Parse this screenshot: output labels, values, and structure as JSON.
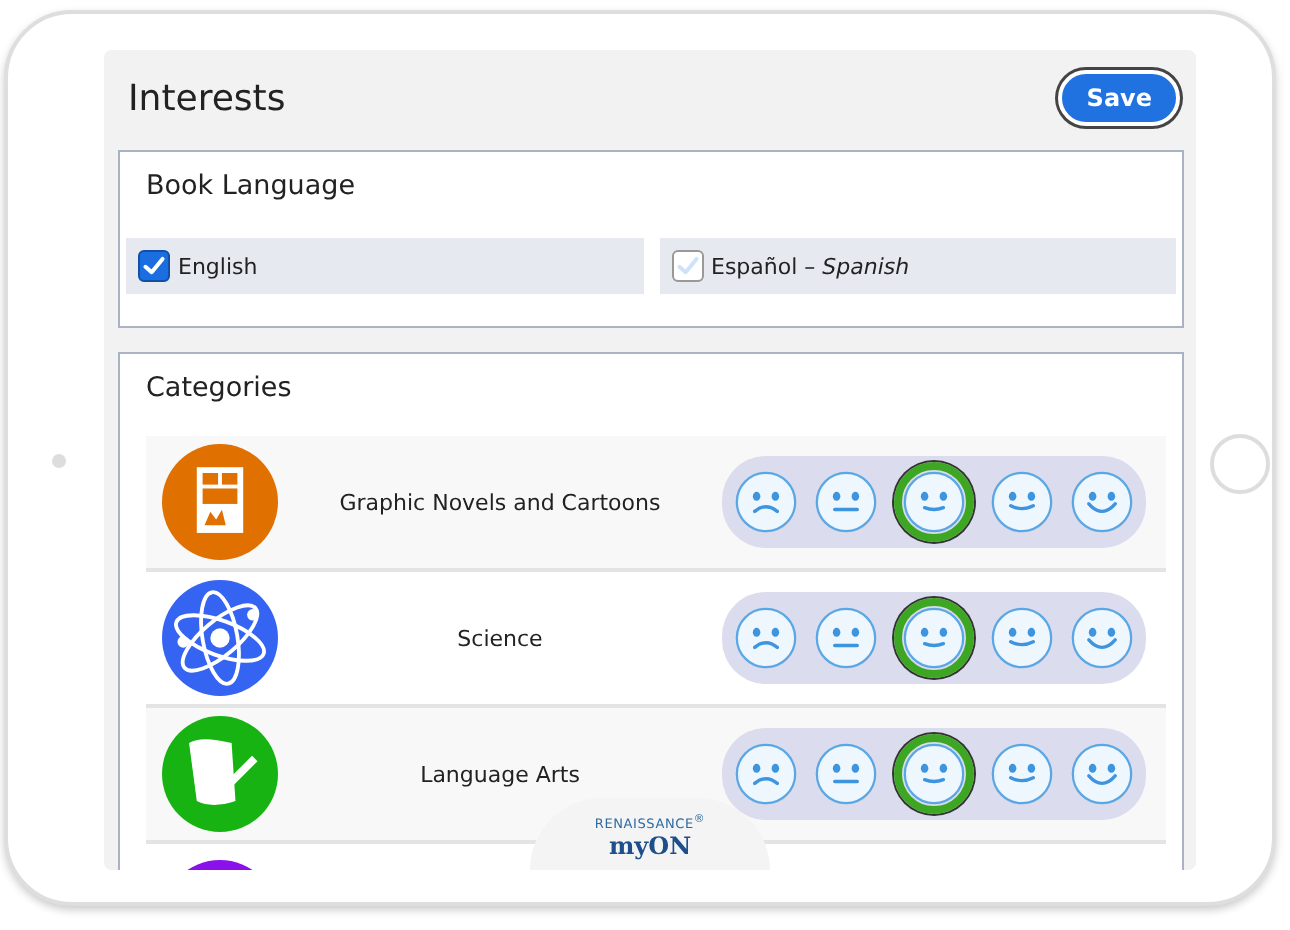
{
  "header": {
    "title": "Interests",
    "save_button": "Save"
  },
  "book_language": {
    "title": "Book Language",
    "options": [
      {
        "label": "English",
        "checked": true
      },
      {
        "label": "Español – *Spanish*",
        "checked": false
      }
    ]
  },
  "categories": {
    "title": "Categories",
    "items": [
      {
        "kind": "comic",
        "name": "Graphic Novels and Cartoons",
        "color": "#e07000",
        "faces": [
          {
            "selected": false
          },
          {
            "selected": false
          },
          {
            "selected": true
          },
          {
            "selected": false
          },
          {
            "selected": false
          }
        ]
      },
      {
        "kind": "atom",
        "name": "Science",
        "color": "#3563f2",
        "faces": [
          {
            "selected": false
          },
          {
            "selected": false
          },
          {
            "selected": true
          },
          {
            "selected": false
          },
          {
            "selected": false
          }
        ]
      },
      {
        "kind": "scroll",
        "name": "Language Arts",
        "color": "#17b312",
        "faces": [
          {
            "selected": false
          },
          {
            "selected": false
          },
          {
            "selected": true
          },
          {
            "selected": false
          },
          {
            "selected": false
          }
        ]
      },
      {
        "kind": "partial",
        "color": "#8a12e8"
      }
    ]
  },
  "logo": {
    "brand": "RENAISSANCE$^{®}$",
    "product": "myON"
  }
}
